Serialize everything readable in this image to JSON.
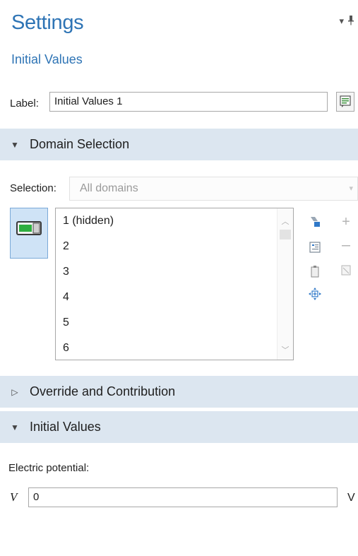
{
  "header": {
    "title": "Settings",
    "subtitle": "Initial Values",
    "controls": {
      "menu_icon": "triangle-down-icon",
      "pin_icon": "pin-icon",
      "menu_glyph": "▾",
      "pin_glyph": "⬍"
    }
  },
  "label_row": {
    "label": "Label:",
    "value": "Initial Values 1",
    "button_icon": "show-description-icon"
  },
  "sections": {
    "domain_selection": {
      "title": "Domain Selection",
      "expanded": true,
      "glyph": "▼"
    },
    "override": {
      "title": "Override and Contribution",
      "expanded": false,
      "glyph": "▷"
    },
    "initial_values": {
      "title": "Initial Values",
      "expanded": true,
      "glyph": "▼"
    }
  },
  "selection": {
    "label": "Selection:",
    "value": "All domains",
    "items": [
      "1 (hidden)",
      "2",
      "3",
      "4",
      "5",
      "6"
    ],
    "toggle_icon": "active-toggle-icon",
    "side_icons": [
      "paste-selection-icon",
      "copy-selection-icon",
      "clear-selection-icon",
      "zoom-to-selection-icon",
      "add-icon",
      "remove-icon",
      "create-selection-icon"
    ]
  },
  "initial_values": {
    "field_label": "Electric potential:",
    "symbol": "V",
    "value": "0",
    "unit": "V"
  }
}
